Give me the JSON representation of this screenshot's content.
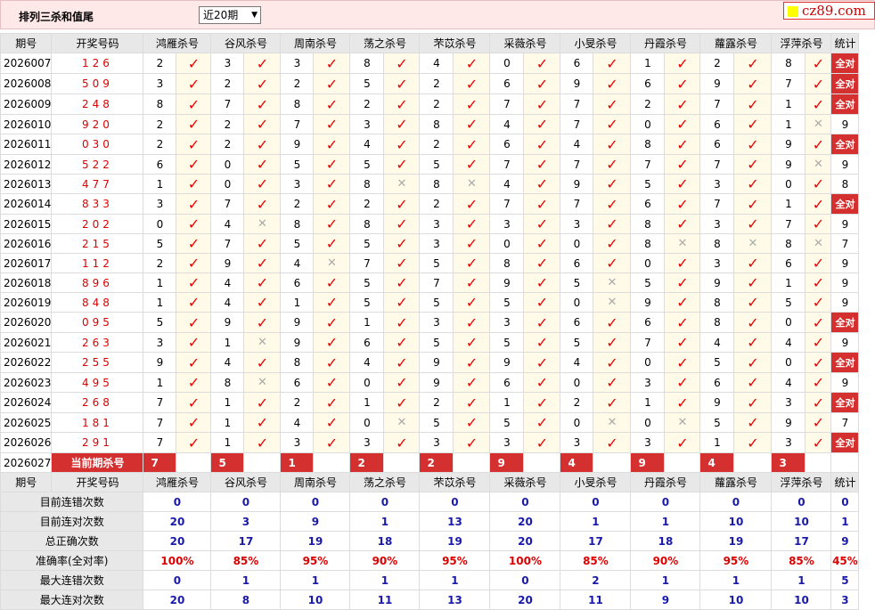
{
  "app": {
    "title": "排列三杀和值尾",
    "period_select": "近20期",
    "logo": "cz89.com"
  },
  "columns": [
    "期号",
    "开奖号码",
    "鸿雁杀号",
    "谷风杀号",
    "周南杀号",
    "荡之杀号",
    "芣苡杀号",
    "采薇杀号",
    "小旻杀号",
    "丹霞杀号",
    "蘿露杀号",
    "浮萍杀号",
    "统计"
  ],
  "all_correct_label": "全对",
  "rows": [
    {
      "issue": "2026007",
      "num": "126",
      "p": [
        2,
        3,
        3,
        8,
        4,
        0,
        6,
        1,
        2,
        8
      ],
      "ok": [
        1,
        1,
        1,
        1,
        1,
        1,
        1,
        1,
        1,
        1
      ],
      "stat": "全对"
    },
    {
      "issue": "2026008",
      "num": "509",
      "p": [
        3,
        2,
        2,
        5,
        2,
        6,
        9,
        6,
        9,
        7
      ],
      "ok": [
        1,
        1,
        1,
        1,
        1,
        1,
        1,
        1,
        1,
        1
      ],
      "stat": "全对"
    },
    {
      "issue": "2026009",
      "num": "248",
      "p": [
        8,
        7,
        8,
        2,
        2,
        7,
        7,
        2,
        7,
        1
      ],
      "ok": [
        1,
        1,
        1,
        1,
        1,
        1,
        1,
        1,
        1,
        1
      ],
      "stat": "全对"
    },
    {
      "issue": "2026010",
      "num": "920",
      "p": [
        2,
        2,
        7,
        3,
        8,
        4,
        7,
        0,
        6,
        1
      ],
      "ok": [
        1,
        1,
        1,
        1,
        1,
        1,
        1,
        1,
        1,
        0
      ],
      "stat": "9"
    },
    {
      "issue": "2026011",
      "num": "030",
      "p": [
        2,
        2,
        9,
        4,
        2,
        6,
        4,
        8,
        6,
        9
      ],
      "ok": [
        1,
        1,
        1,
        1,
        1,
        1,
        1,
        1,
        1,
        1
      ],
      "stat": "全对"
    },
    {
      "issue": "2026012",
      "num": "522",
      "p": [
        6,
        0,
        5,
        5,
        5,
        7,
        7,
        7,
        7,
        9
      ],
      "ok": [
        1,
        1,
        1,
        1,
        1,
        1,
        1,
        1,
        1,
        0
      ],
      "stat": "9"
    },
    {
      "issue": "2026013",
      "num": "477",
      "p": [
        1,
        0,
        3,
        8,
        8,
        4,
        9,
        5,
        3,
        0
      ],
      "ok": [
        1,
        1,
        1,
        0,
        0,
        1,
        1,
        1,
        1,
        1
      ],
      "stat": "8"
    },
    {
      "issue": "2026014",
      "num": "833",
      "p": [
        3,
        7,
        2,
        2,
        2,
        7,
        7,
        6,
        7,
        1
      ],
      "ok": [
        1,
        1,
        1,
        1,
        1,
        1,
        1,
        1,
        1,
        1
      ],
      "stat": "全对"
    },
    {
      "issue": "2026015",
      "num": "202",
      "p": [
        0,
        4,
        8,
        8,
        3,
        3,
        3,
        8,
        3,
        7
      ],
      "ok": [
        1,
        0,
        1,
        1,
        1,
        1,
        1,
        1,
        1,
        1
      ],
      "stat": "9"
    },
    {
      "issue": "2026016",
      "num": "215",
      "p": [
        5,
        7,
        5,
        5,
        3,
        0,
        0,
        8,
        8,
        8
      ],
      "ok": [
        1,
        1,
        1,
        1,
        1,
        1,
        1,
        0,
        0,
        0
      ],
      "stat": "7"
    },
    {
      "issue": "2026017",
      "num": "112",
      "p": [
        2,
        9,
        4,
        7,
        5,
        8,
        6,
        0,
        3,
        6
      ],
      "ok": [
        1,
        1,
        0,
        1,
        1,
        1,
        1,
        1,
        1,
        1
      ],
      "stat": "9"
    },
    {
      "issue": "2026018",
      "num": "896",
      "p": [
        1,
        4,
        6,
        5,
        7,
        9,
        5,
        5,
        9,
        1
      ],
      "ok": [
        1,
        1,
        1,
        1,
        1,
        1,
        0,
        1,
        1,
        1
      ],
      "stat": "9"
    },
    {
      "issue": "2026019",
      "num": "848",
      "p": [
        1,
        4,
        1,
        5,
        5,
        5,
        0,
        9,
        8,
        5
      ],
      "ok": [
        1,
        1,
        1,
        1,
        1,
        1,
        0,
        1,
        1,
        1
      ],
      "stat": "9"
    },
    {
      "issue": "2026020",
      "num": "095",
      "p": [
        5,
        9,
        9,
        1,
        3,
        3,
        6,
        6,
        8,
        0
      ],
      "ok": [
        1,
        1,
        1,
        1,
        1,
        1,
        1,
        1,
        1,
        1
      ],
      "stat": "全对"
    },
    {
      "issue": "2026021",
      "num": "263",
      "p": [
        3,
        1,
        9,
        6,
        5,
        5,
        5,
        7,
        4,
        4
      ],
      "ok": [
        1,
        0,
        1,
        1,
        1,
        1,
        1,
        1,
        1,
        1
      ],
      "stat": "9"
    },
    {
      "issue": "2026022",
      "num": "255",
      "p": [
        9,
        4,
        8,
        4,
        9,
        9,
        4,
        0,
        5,
        0
      ],
      "ok": [
        1,
        1,
        1,
        1,
        1,
        1,
        1,
        1,
        1,
        1
      ],
      "stat": "全对"
    },
    {
      "issue": "2026023",
      "num": "495",
      "p": [
        1,
        8,
        6,
        0,
        9,
        6,
        0,
        3,
        6,
        4
      ],
      "ok": [
        1,
        0,
        1,
        1,
        1,
        1,
        1,
        1,
        1,
        1
      ],
      "stat": "9"
    },
    {
      "issue": "2026024",
      "num": "268",
      "p": [
        7,
        1,
        2,
        1,
        2,
        1,
        2,
        1,
        9,
        3
      ],
      "ok": [
        1,
        1,
        1,
        1,
        1,
        1,
        1,
        1,
        1,
        1
      ],
      "stat": "全对"
    },
    {
      "issue": "2026025",
      "num": "181",
      "p": [
        7,
        1,
        4,
        0,
        5,
        5,
        0,
        0,
        5,
        9
      ],
      "ok": [
        1,
        1,
        1,
        0,
        1,
        1,
        0,
        0,
        1,
        1
      ],
      "stat": "7"
    },
    {
      "issue": "2026026",
      "num": "291",
      "p": [
        7,
        1,
        3,
        3,
        3,
        3,
        3,
        3,
        1,
        3
      ],
      "ok": [
        1,
        1,
        1,
        1,
        1,
        1,
        1,
        1,
        1,
        1
      ],
      "stat": "全对"
    }
  ],
  "current": {
    "issue": "2026027",
    "label": "当前期杀号",
    "picks": [
      7,
      5,
      1,
      2,
      2,
      9,
      4,
      9,
      4,
      3
    ]
  },
  "stats": [
    {
      "label": "目前连错次数",
      "vals": [
        "0",
        "0",
        "0",
        "0",
        "0",
        "0",
        "0",
        "0",
        "0",
        "0",
        "0"
      ],
      "red": false
    },
    {
      "label": "目前连对次数",
      "vals": [
        "20",
        "3",
        "9",
        "1",
        "13",
        "20",
        "1",
        "1",
        "10",
        "10",
        "1"
      ],
      "red": false
    },
    {
      "label": "总正确次数",
      "vals": [
        "20",
        "17",
        "19",
        "18",
        "19",
        "20",
        "17",
        "18",
        "19",
        "17",
        "9"
      ],
      "red": false
    },
    {
      "label": "准确率(全对率)",
      "vals": [
        "100%",
        "85%",
        "95%",
        "90%",
        "95%",
        "100%",
        "85%",
        "90%",
        "95%",
        "85%",
        "45%"
      ],
      "red": true
    },
    {
      "label": "最大连错次数",
      "vals": [
        "0",
        "1",
        "1",
        "1",
        "1",
        "0",
        "2",
        "1",
        "1",
        "1",
        "5"
      ],
      "red": false
    },
    {
      "label": "最大连对次数",
      "vals": [
        "20",
        "8",
        "10",
        "11",
        "13",
        "20",
        "11",
        "9",
        "10",
        "10",
        "3"
      ],
      "red": false
    }
  ]
}
